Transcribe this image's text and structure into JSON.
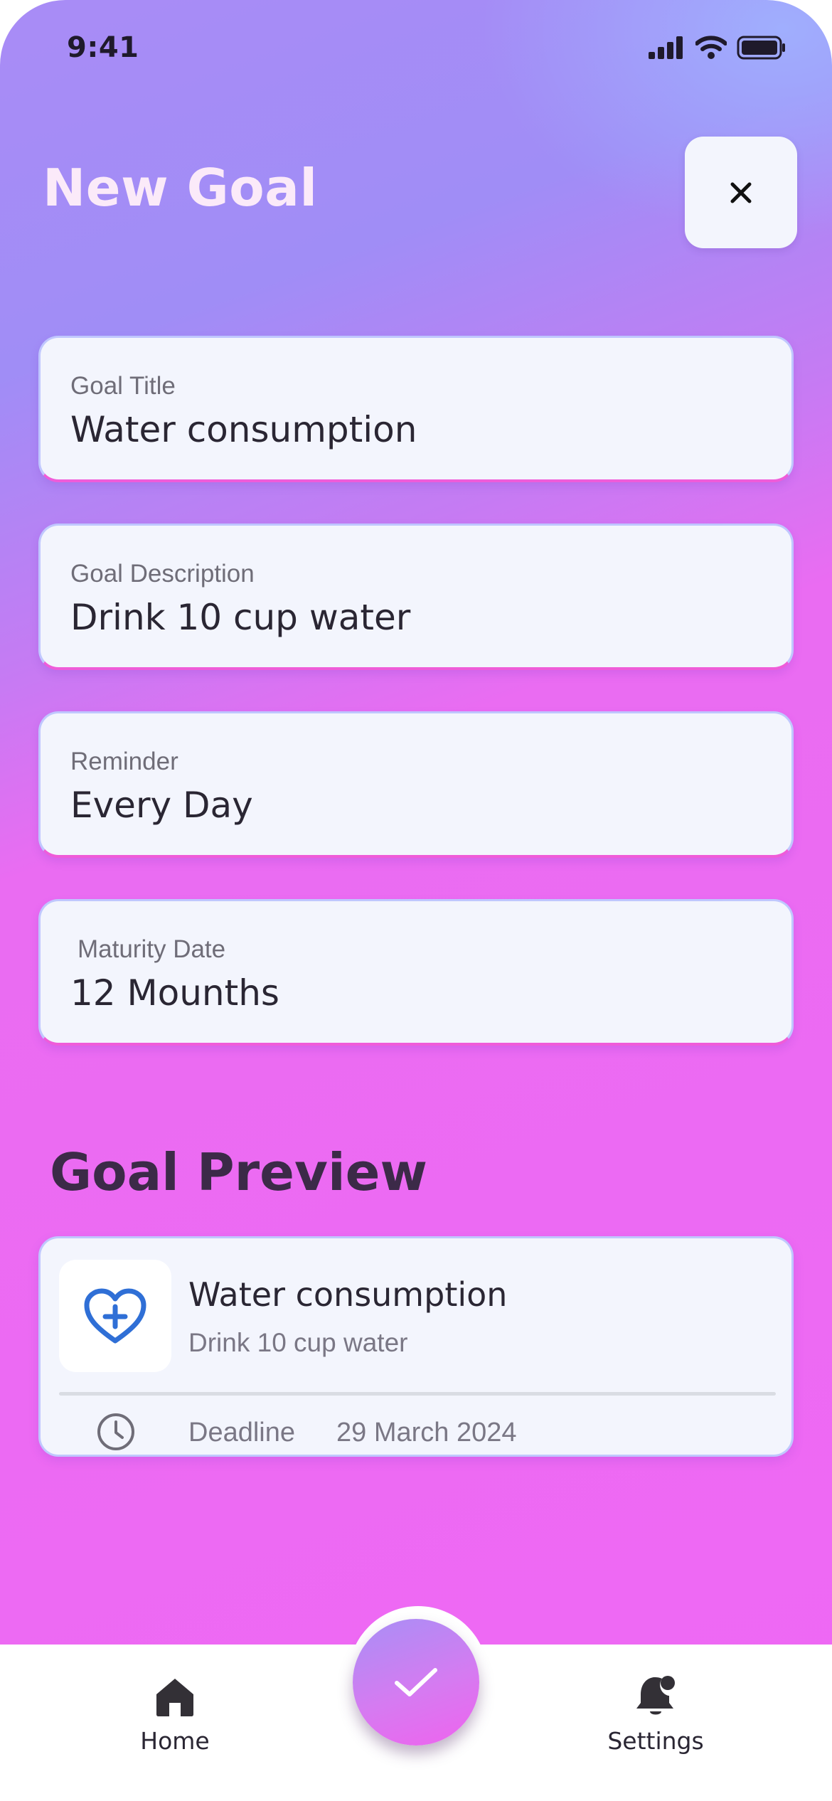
{
  "status_bar": {
    "time": "9:41"
  },
  "header": {
    "title": "New Goal",
    "close_icon": "close-icon"
  },
  "form": {
    "fields": [
      {
        "label": "Goal Title",
        "value": "Water consumption"
      },
      {
        "label": "Goal Description",
        "value": "Drink 10 cup water"
      },
      {
        "label": "Reminder",
        "value": "Every Day"
      },
      {
        "label": "Maturity Date",
        "value": "12 Mounths"
      }
    ]
  },
  "preview": {
    "section_title": "Goal Preview",
    "card": {
      "icon": "heart-plus-icon",
      "title": "Water consumption",
      "description": "Drink 10 cup water",
      "deadline_label": "Deadline",
      "deadline_date": "29 March 2024"
    }
  },
  "tab_bar": {
    "home_label": "Home",
    "settings_label": "Settings",
    "confirm_icon": "check-icon"
  },
  "colors": {
    "accent_pink": "#ef68f4",
    "accent_purple": "#a08df6",
    "card_bg": "#f3f5fd",
    "heart_icon_blue": "#2f6fd6"
  }
}
